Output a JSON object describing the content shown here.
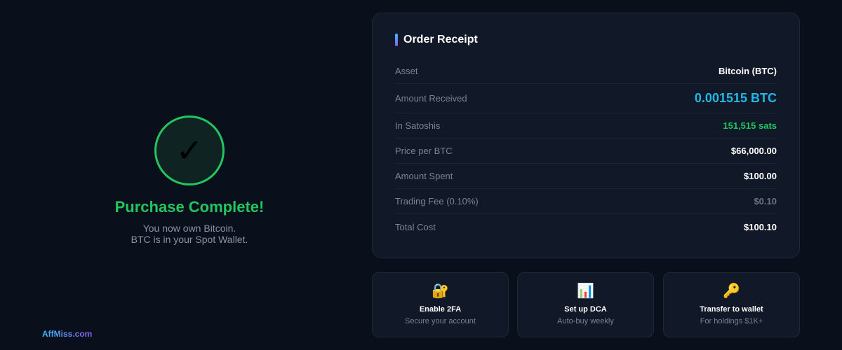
{
  "success": {
    "check_symbol": "✓",
    "title": "Purchase Complete!",
    "line1": "You now own Bitcoin.",
    "line2": "BTC is in your Spot Wallet."
  },
  "brand": "AffMiss.com",
  "receipt": {
    "title": "Order Receipt",
    "rows": [
      {
        "label": "Asset",
        "value": "Bitcoin (BTC)"
      },
      {
        "label": "Amount Received",
        "value": "0.001515 BTC"
      },
      {
        "label": "In Satoshis",
        "value": "151,515 sats"
      },
      {
        "label": "Price per BTC",
        "value": "$66,000.00"
      },
      {
        "label": "Amount Spent",
        "value": "$100.00"
      },
      {
        "label": "Trading Fee (0.10%)",
        "value": "$0.10"
      },
      {
        "label": "Total Cost",
        "value": "$100.10"
      }
    ]
  },
  "actions": [
    {
      "icon": "🔐",
      "icon_name": "lock-key-icon",
      "title": "Enable 2FA",
      "subtitle": "Secure your account"
    },
    {
      "icon": "📊",
      "icon_name": "bar-chart-icon",
      "title": "Set up DCA",
      "subtitle": "Auto-buy weekly"
    },
    {
      "icon": "🔑",
      "icon_name": "key-icon",
      "title": "Transfer to wallet",
      "subtitle": "For holdings $1K+"
    }
  ],
  "colors": {
    "background": "#0a0f1c",
    "card": "#111827",
    "success_green": "#22c55e",
    "btc_cyan": "#22b8e6",
    "muted": "#7b8494"
  }
}
